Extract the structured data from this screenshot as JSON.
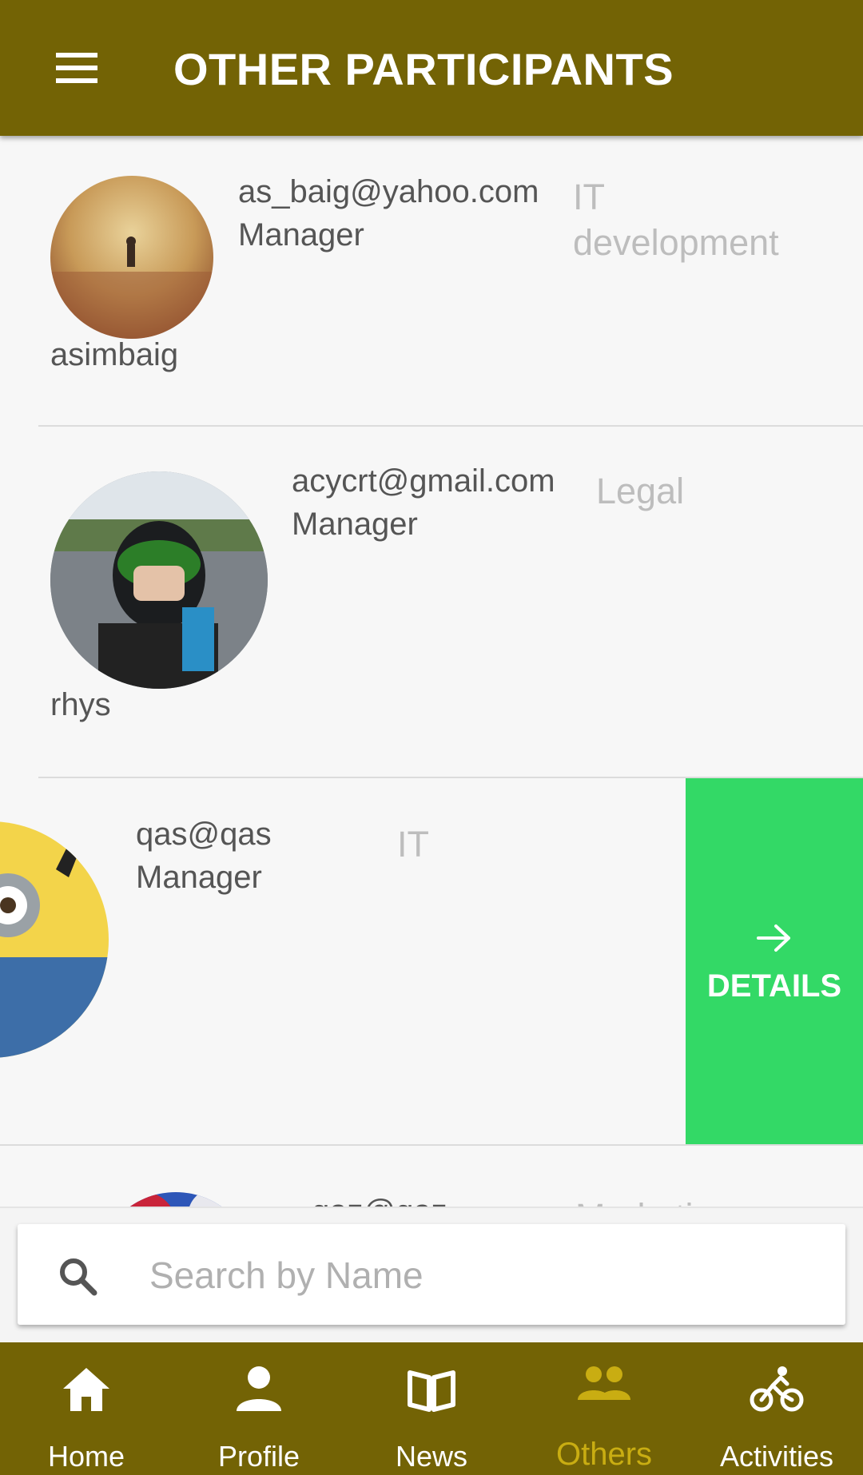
{
  "header": {
    "title": "OTHER PARTICIPANTS",
    "menu_icon": "hamburger-menu-icon"
  },
  "participants": [
    {
      "name": "asimbaig",
      "email": "as_baig@yahoo.com",
      "role": "Manager",
      "department": "IT development"
    },
    {
      "name": "rhys",
      "email": "acycrt@gmail.com",
      "role": "Manager",
      "department": "Legal"
    },
    {
      "name": "",
      "email": "qas@qas",
      "role": "Manager",
      "department": "IT"
    },
    {
      "name": "",
      "email": "qaz@qaz",
      "role": "",
      "department": "Marketing"
    }
  ],
  "details_action": {
    "label": "DETAILS",
    "icon": "arrow-right-icon",
    "color": "#33d966"
  },
  "search": {
    "placeholder": "Search by Name",
    "value": "",
    "icon": "search-icon"
  },
  "bottom_nav": {
    "items": [
      {
        "label": "Home",
        "icon": "home-icon"
      },
      {
        "label": "Profile",
        "icon": "person-icon"
      },
      {
        "label": "News",
        "icon": "book-icon"
      },
      {
        "label": "Others",
        "icon": "people-icon"
      },
      {
        "label": "Activities",
        "icon": "bicycle-icon"
      }
    ],
    "active": "Others"
  },
  "colors": {
    "primary": "#736305",
    "accent": "#c9ad12",
    "details": "#33d966"
  }
}
